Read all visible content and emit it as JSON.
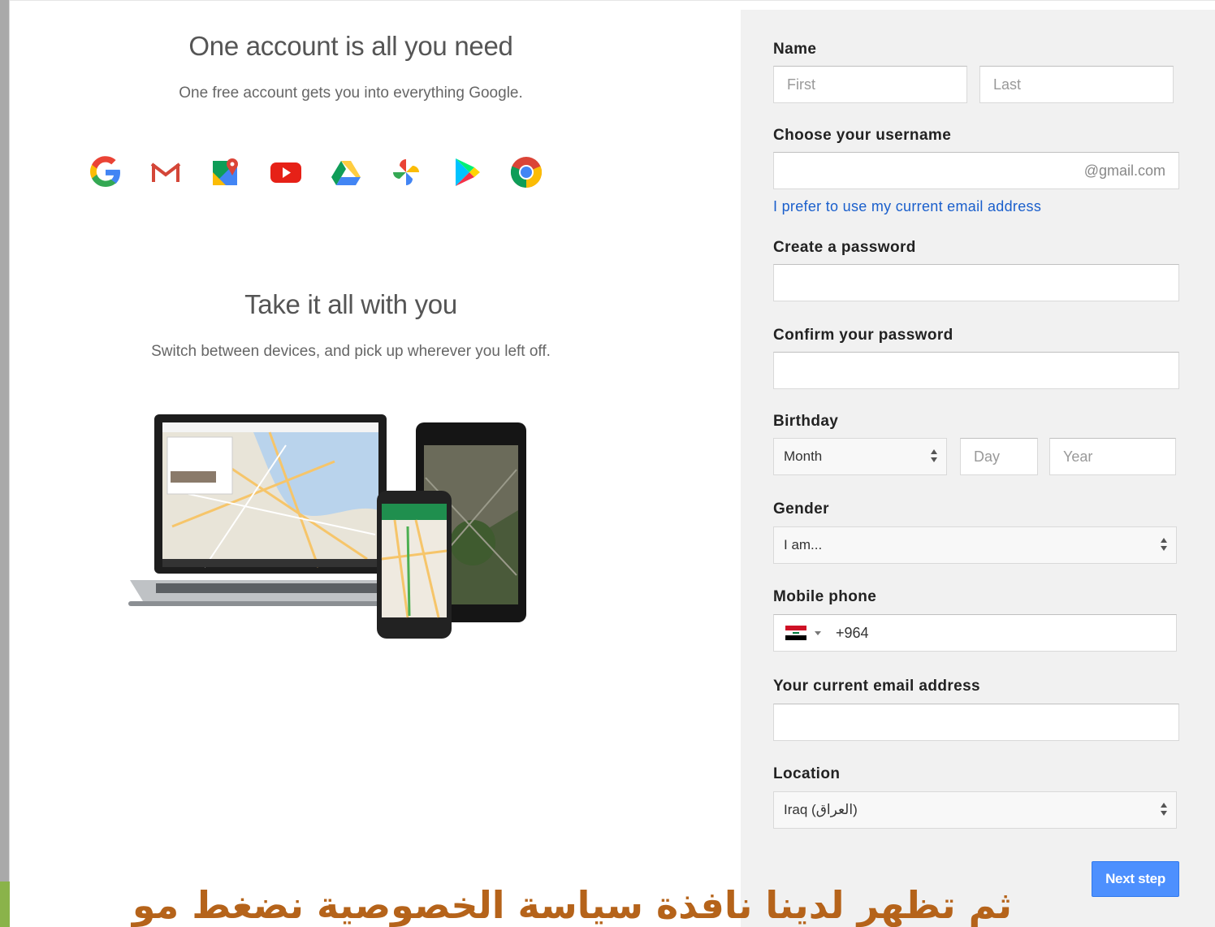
{
  "left": {
    "title1": "One account is all you need",
    "subtitle1": "One free account gets you into everything Google.",
    "apps": [
      "google-icon",
      "gmail-icon",
      "maps-icon",
      "youtube-icon",
      "drive-icon",
      "photos-icon",
      "play-icon",
      "chrome-icon"
    ],
    "title2": "Take it all with you",
    "subtitle2": "Switch between devices, and pick up wherever you left off."
  },
  "form": {
    "name_label": "Name",
    "first_placeholder": "First",
    "last_placeholder": "Last",
    "username_label": "Choose your username",
    "username_suffix": "@gmail.com",
    "use_current_email_link": "I prefer to use my current email address",
    "password_label": "Create a password",
    "confirm_label": "Confirm your password",
    "birthday_label": "Birthday",
    "month_value": "Month",
    "day_placeholder": "Day",
    "year_placeholder": "Year",
    "gender_label": "Gender",
    "gender_value": "I am...",
    "mobile_label": "Mobile phone",
    "phone_code": "+964",
    "current_email_label": "Your current email address",
    "location_label": "Location",
    "location_value": "Iraq (العراق)",
    "next_button": "Next step"
  },
  "caption": "ثم تظهر لدينا نافذة سياسة الخصوصية نضغط مو",
  "colors": {
    "accent_blue": "#4d90fe",
    "link_blue": "#1a5fcc",
    "caption_orange": "#b5631a",
    "panel_grey": "#f1f1f1"
  }
}
